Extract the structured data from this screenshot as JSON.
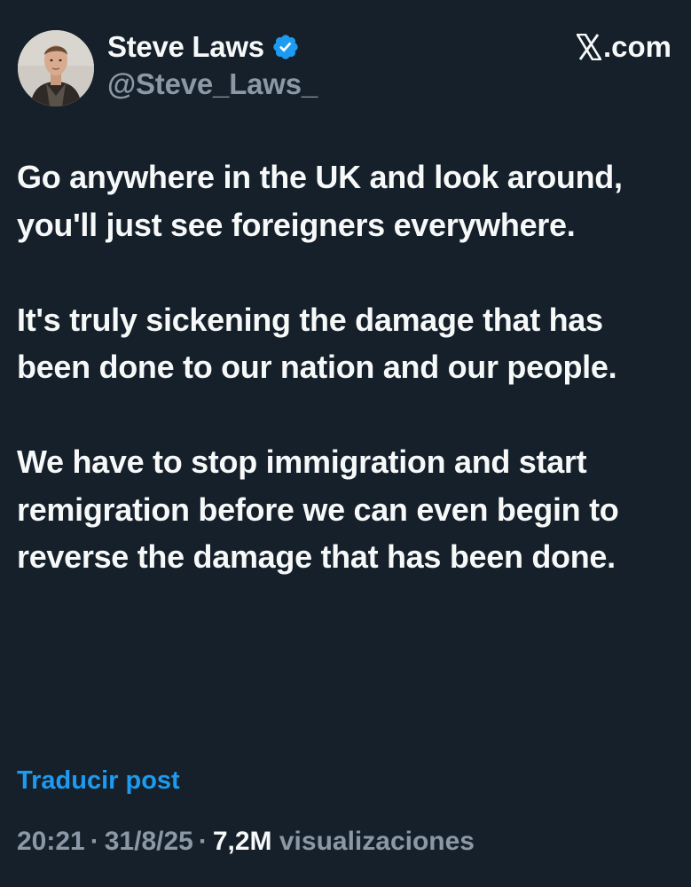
{
  "author": {
    "display_name": "Steve Laws",
    "handle": "@Steve_Laws_",
    "verified": true,
    "verified_color": "#1d9bf0",
    "avatar_icon": "profile-photo"
  },
  "brand": {
    "label": ".com",
    "logo_icon": "x-logo-icon"
  },
  "post": {
    "paragraphs": [
      "Go anywhere in the UK and look around, you'll just see foreigners everywhere.",
      "It's truly sickening the damage that has been done to our nation and our people.",
      "We have to stop immigration and start remigration before we can even begin to reverse the damage that has been done."
    ],
    "translate_label": "Traducir post"
  },
  "meta": {
    "time": "20:21",
    "separator": "·",
    "date": "31/8/25",
    "views_count": "7,2M",
    "views_label": "visualizaciones"
  },
  "colors": {
    "background": "#15202b",
    "text": "#f7f9f9",
    "secondary_text": "#8b98a5",
    "link": "#1d9bf0"
  }
}
